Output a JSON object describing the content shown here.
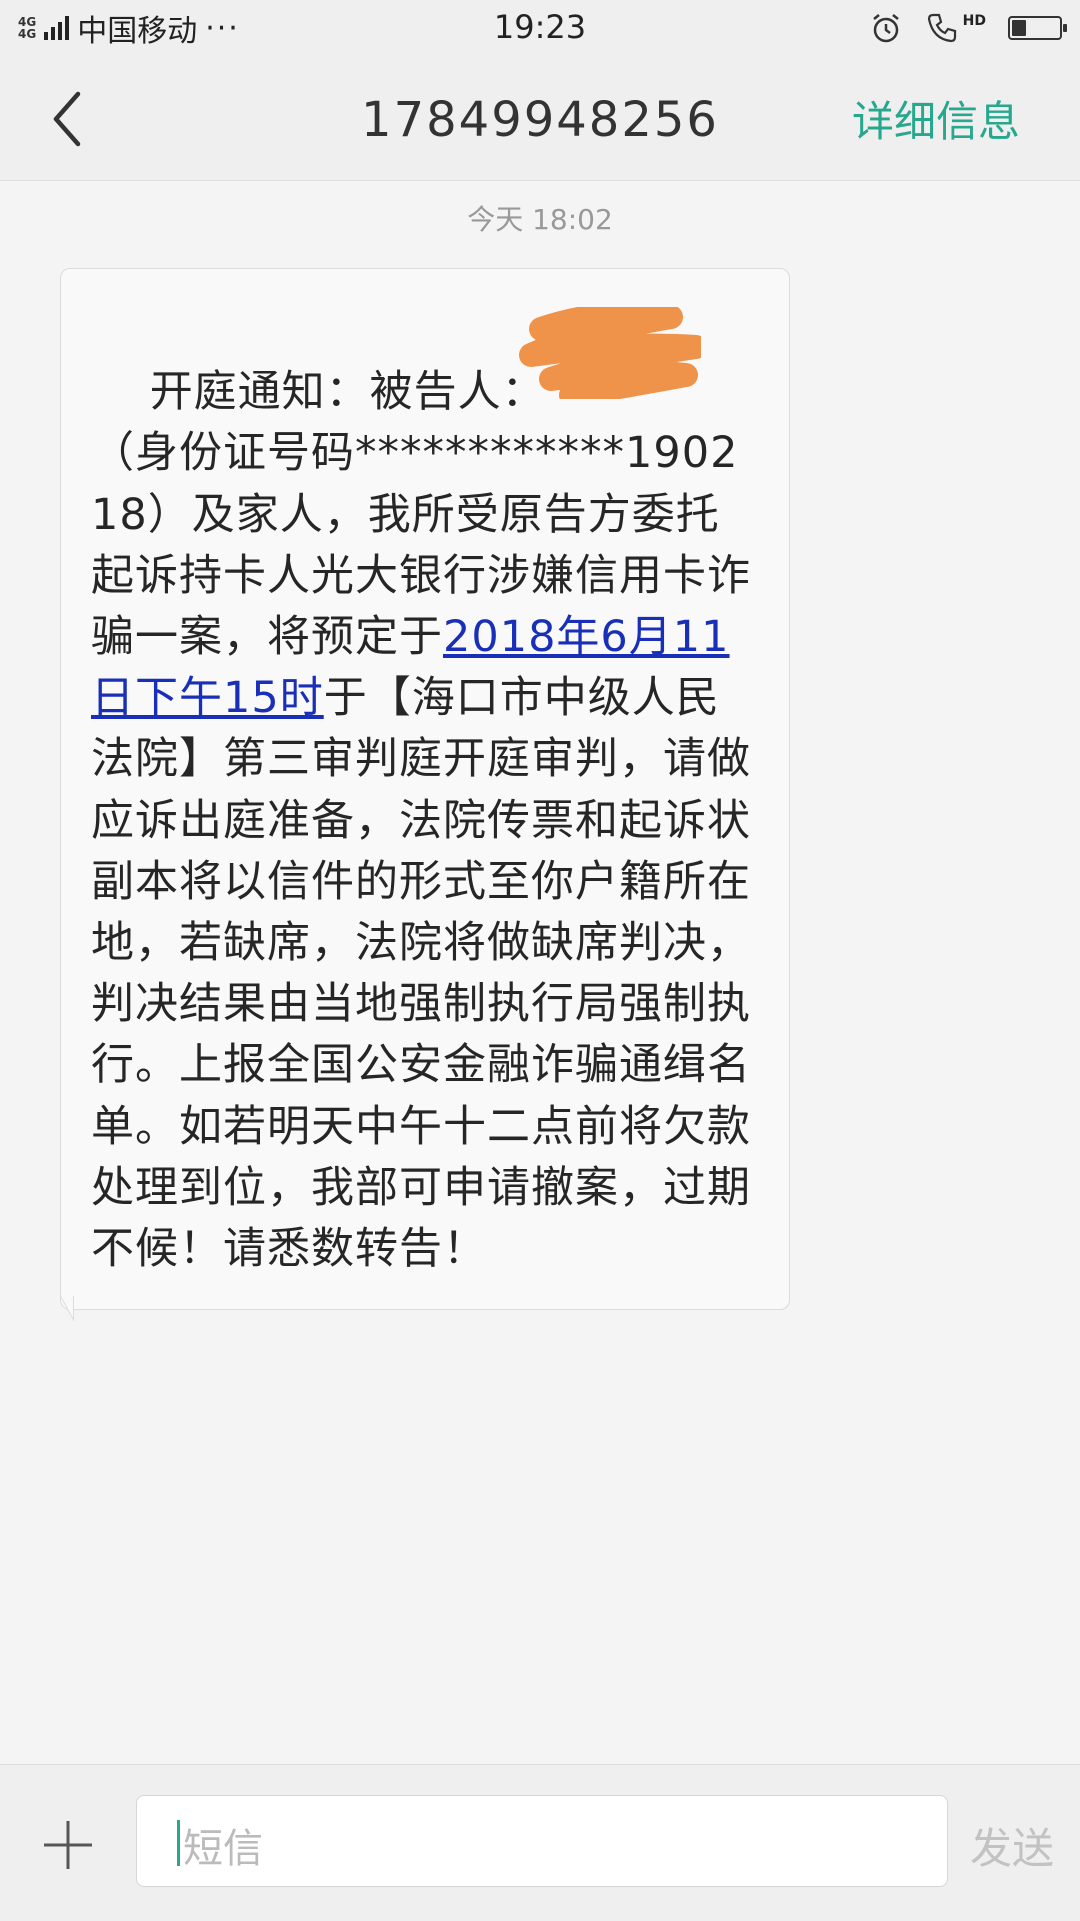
{
  "status_bar": {
    "network": [
      "4G",
      "4G"
    ],
    "carrier": "中国移动",
    "more": "···",
    "time": "19:23",
    "hd_label": "HD",
    "battery_level": 0.3
  },
  "header": {
    "title": "17849948256",
    "details_label": "详细信息"
  },
  "timestamp": "今天 18:02",
  "message": {
    "segments": [
      {
        "type": "text",
        "text": "开庭通知：被告人：　　　　（身份证号码************190218）及家人，我所受原告方委托起诉持卡人光大银行涉嫌信用卡诈骗一案，将预定于"
      },
      {
        "type": "link",
        "text": "2018年6月11日下午15时"
      },
      {
        "type": "text",
        "text": "于【海口市中级人民法院】第三审判庭开庭审判，请做应诉出庭准备，法院传票和起诉状副本将以信件的形式至你户籍所在地，若缺席，法院将做缺席判决，判决结果由当地强制执行局强制执行。上报全国公安金融诈骗通缉名单。如若明天中午十二点前将欠款处理到位，我部可申请撤案，过期不候！请悉数转告！"
      }
    ]
  },
  "input": {
    "placeholder": "短信",
    "send_label": "发送"
  },
  "colors": {
    "accent": "#27a88e",
    "link": "#1a2fb8",
    "redaction": "#f0934a"
  }
}
